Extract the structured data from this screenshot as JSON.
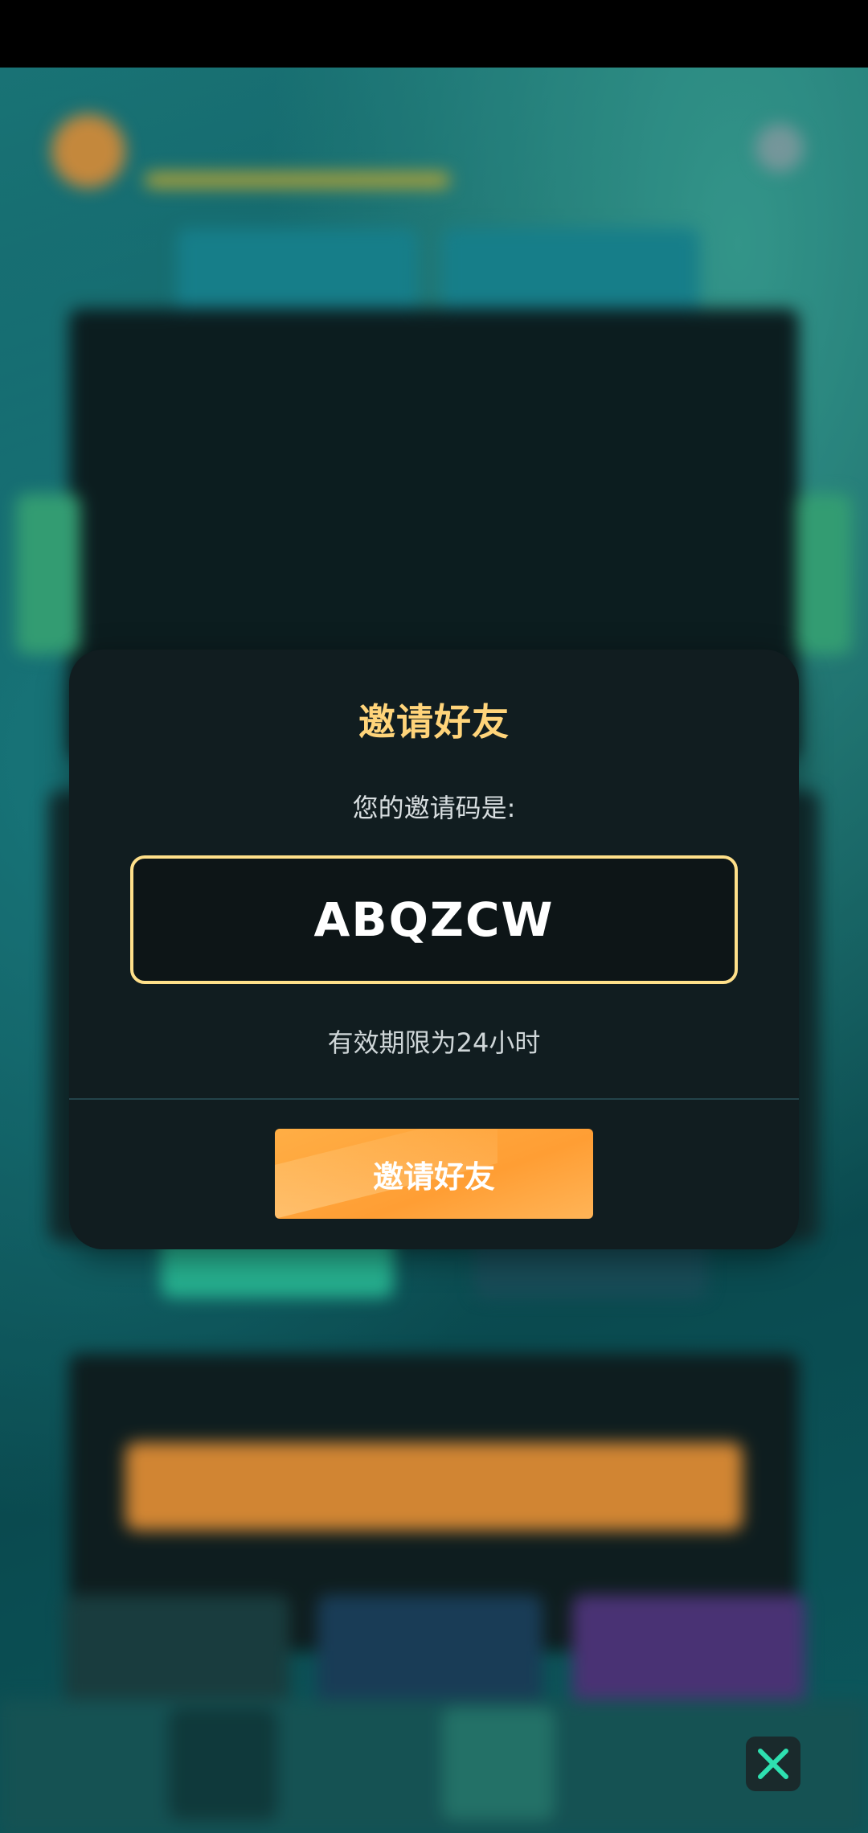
{
  "modal": {
    "title": "邀请好友",
    "prompt": "您的邀请码是:",
    "invite_code": "ABQZCW",
    "validity": "有效期限为24小时",
    "primary_button": "邀请好友"
  },
  "icons": {
    "close": "close-icon"
  },
  "colors": {
    "title": "#ffd47a",
    "code_border": "#ffe08a",
    "button": "#ffa33f",
    "modal_bg": "#111d20",
    "close_x": "#2ee0b0"
  }
}
